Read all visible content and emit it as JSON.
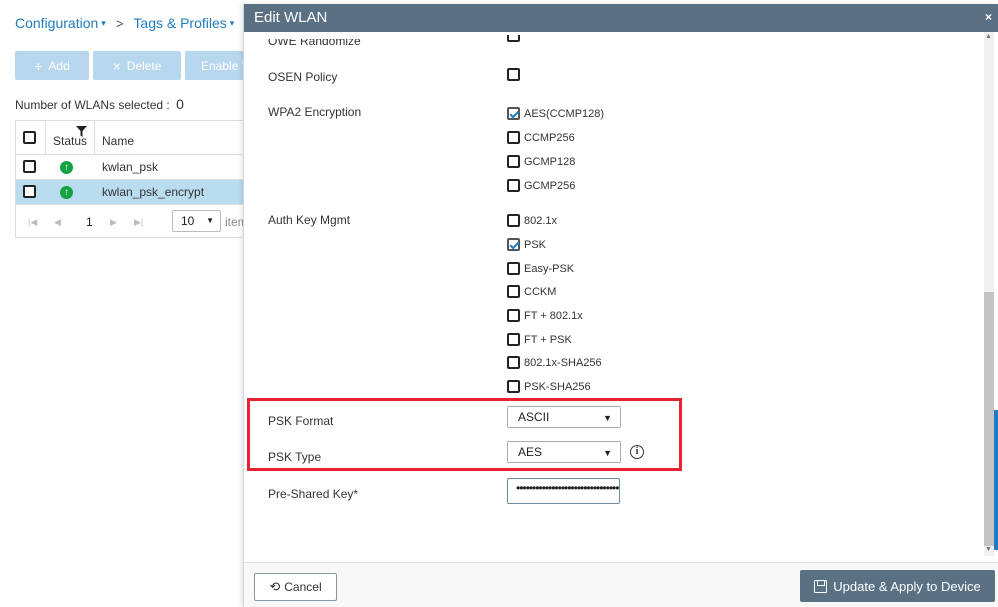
{
  "breadcrumb": {
    "configuration": "Configuration",
    "tags_profiles": "Tags & Profiles",
    "caret": "▾",
    "separator": ">"
  },
  "toolbar": {
    "add": "Add",
    "delete": "Delete",
    "enable": "Enable V"
  },
  "wlan_list": {
    "selected_label": "Number of WLANs selected :",
    "selected_count": "0",
    "columns": {
      "status": "Status",
      "name": "Name"
    },
    "rows": [
      {
        "name": "kwlan_psk",
        "status": "up"
      },
      {
        "name": "kwlan_psk_encrypt",
        "status": "up"
      }
    ],
    "pager": {
      "page": "1",
      "page_size": "10",
      "items_label": "item"
    }
  },
  "modal": {
    "title": "Edit WLAN",
    "close": "×",
    "truncated_top_label": "OWE Randomize",
    "osen_policy": {
      "label": "OSEN Policy",
      "checked": false
    },
    "wpa2_encryption": {
      "label": "WPA2 Encryption",
      "options": [
        {
          "label": "AES(CCMP128)",
          "checked": true
        },
        {
          "label": "CCMP256",
          "checked": false
        },
        {
          "label": "GCMP128",
          "checked": false
        },
        {
          "label": "GCMP256",
          "checked": false
        }
      ]
    },
    "auth_key_mgmt": {
      "label": "Auth Key Mgmt",
      "options": [
        {
          "label": "802.1x",
          "checked": false
        },
        {
          "label": "PSK",
          "checked": true
        },
        {
          "label": "Easy-PSK",
          "checked": false
        },
        {
          "label": "CCKM",
          "checked": false
        },
        {
          "label": "FT + 802.1x",
          "checked": false
        },
        {
          "label": "FT + PSK",
          "checked": false
        },
        {
          "label": "802.1x-SHA256",
          "checked": false
        },
        {
          "label": "PSK-SHA256",
          "checked": false
        }
      ]
    },
    "psk_format": {
      "label": "PSK Format",
      "value": "ASCII"
    },
    "psk_type": {
      "label": "PSK Type",
      "value": "AES"
    },
    "pre_shared_key": {
      "label": "Pre-Shared Key*",
      "value": "••••••••••••••••••••••••••••••••"
    },
    "footer": {
      "cancel": "Cancel",
      "update": "Update & Apply to Device"
    }
  },
  "colors": {
    "header_bg": "#5a7083",
    "highlight_box": "#e8232f",
    "link_blue": "#1f7bc1",
    "selected_row": "#b9dcef",
    "status_up": "#14a344"
  }
}
